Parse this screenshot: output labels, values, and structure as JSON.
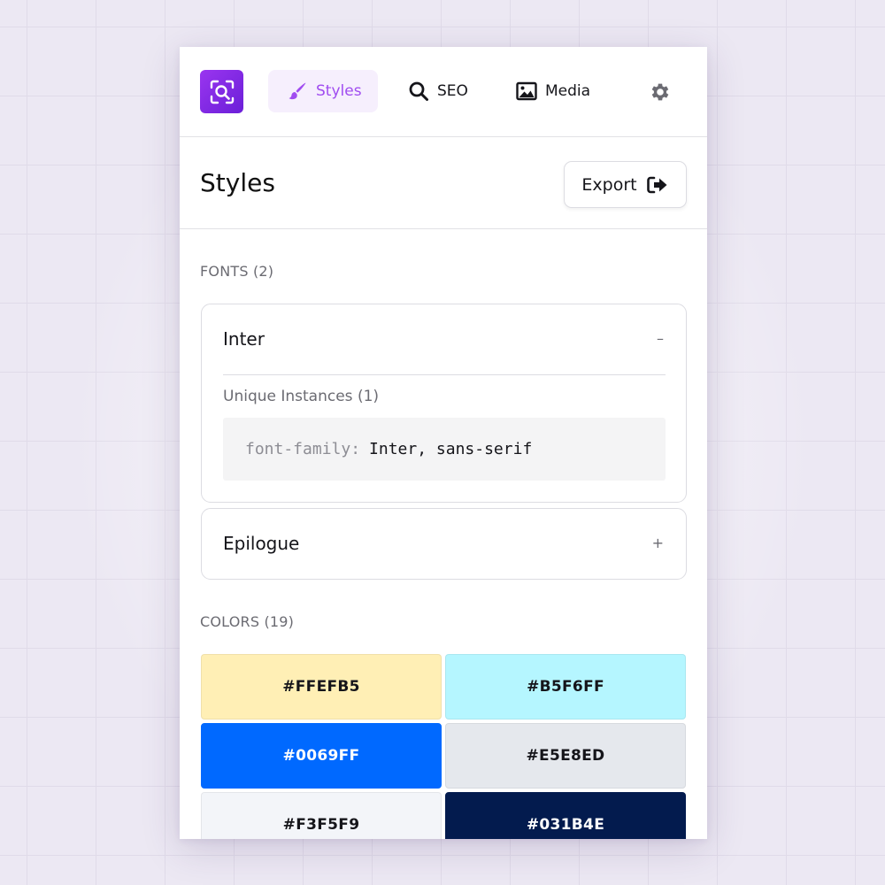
{
  "nav": {
    "tabs": [
      {
        "label": "Styles",
        "icon": "brush-icon",
        "active": true
      },
      {
        "label": "SEO",
        "icon": "search-icon",
        "active": false
      },
      {
        "label": "Media",
        "icon": "image-icon",
        "active": false
      }
    ],
    "settings_icon": "gear-icon",
    "logo_icon": "magnify-logo-icon"
  },
  "header": {
    "title": "Styles",
    "export_label": "Export"
  },
  "fonts": {
    "section_label": "FONTS (2)",
    "items": [
      {
        "name": "Inter",
        "toggle": "–",
        "expanded": true,
        "instances_label": "Unique Instances (1)",
        "code_property": "font-family:",
        "code_value": "Inter, sans-serif"
      },
      {
        "name": "Epilogue",
        "toggle": "+",
        "expanded": false
      }
    ]
  },
  "colors": {
    "section_label": "COLORS (19)",
    "swatches": [
      {
        "hex": "#FFEFB5",
        "bg": "#FFEFB5",
        "text": "#15151a"
      },
      {
        "hex": "#B5F6FF",
        "bg": "#B5F6FF",
        "text": "#15151a"
      },
      {
        "hex": "#0069FF",
        "bg": "#0069FF",
        "text": "#ffffff"
      },
      {
        "hex": "#E5E8ED",
        "bg": "#E5E8ED",
        "text": "#15151a"
      },
      {
        "hex": "#F3F5F9",
        "bg": "#F3F5F9",
        "text": "#15151a"
      },
      {
        "hex": "#031B4E",
        "bg": "#031B4E",
        "text": "#ffffff"
      }
    ]
  },
  "theme": {
    "accent": "#A04CF0",
    "accent_bg": "#F6EFFD",
    "logo_gradient_start": "#9A35F0",
    "logo_gradient_end": "#6B1FD8"
  }
}
